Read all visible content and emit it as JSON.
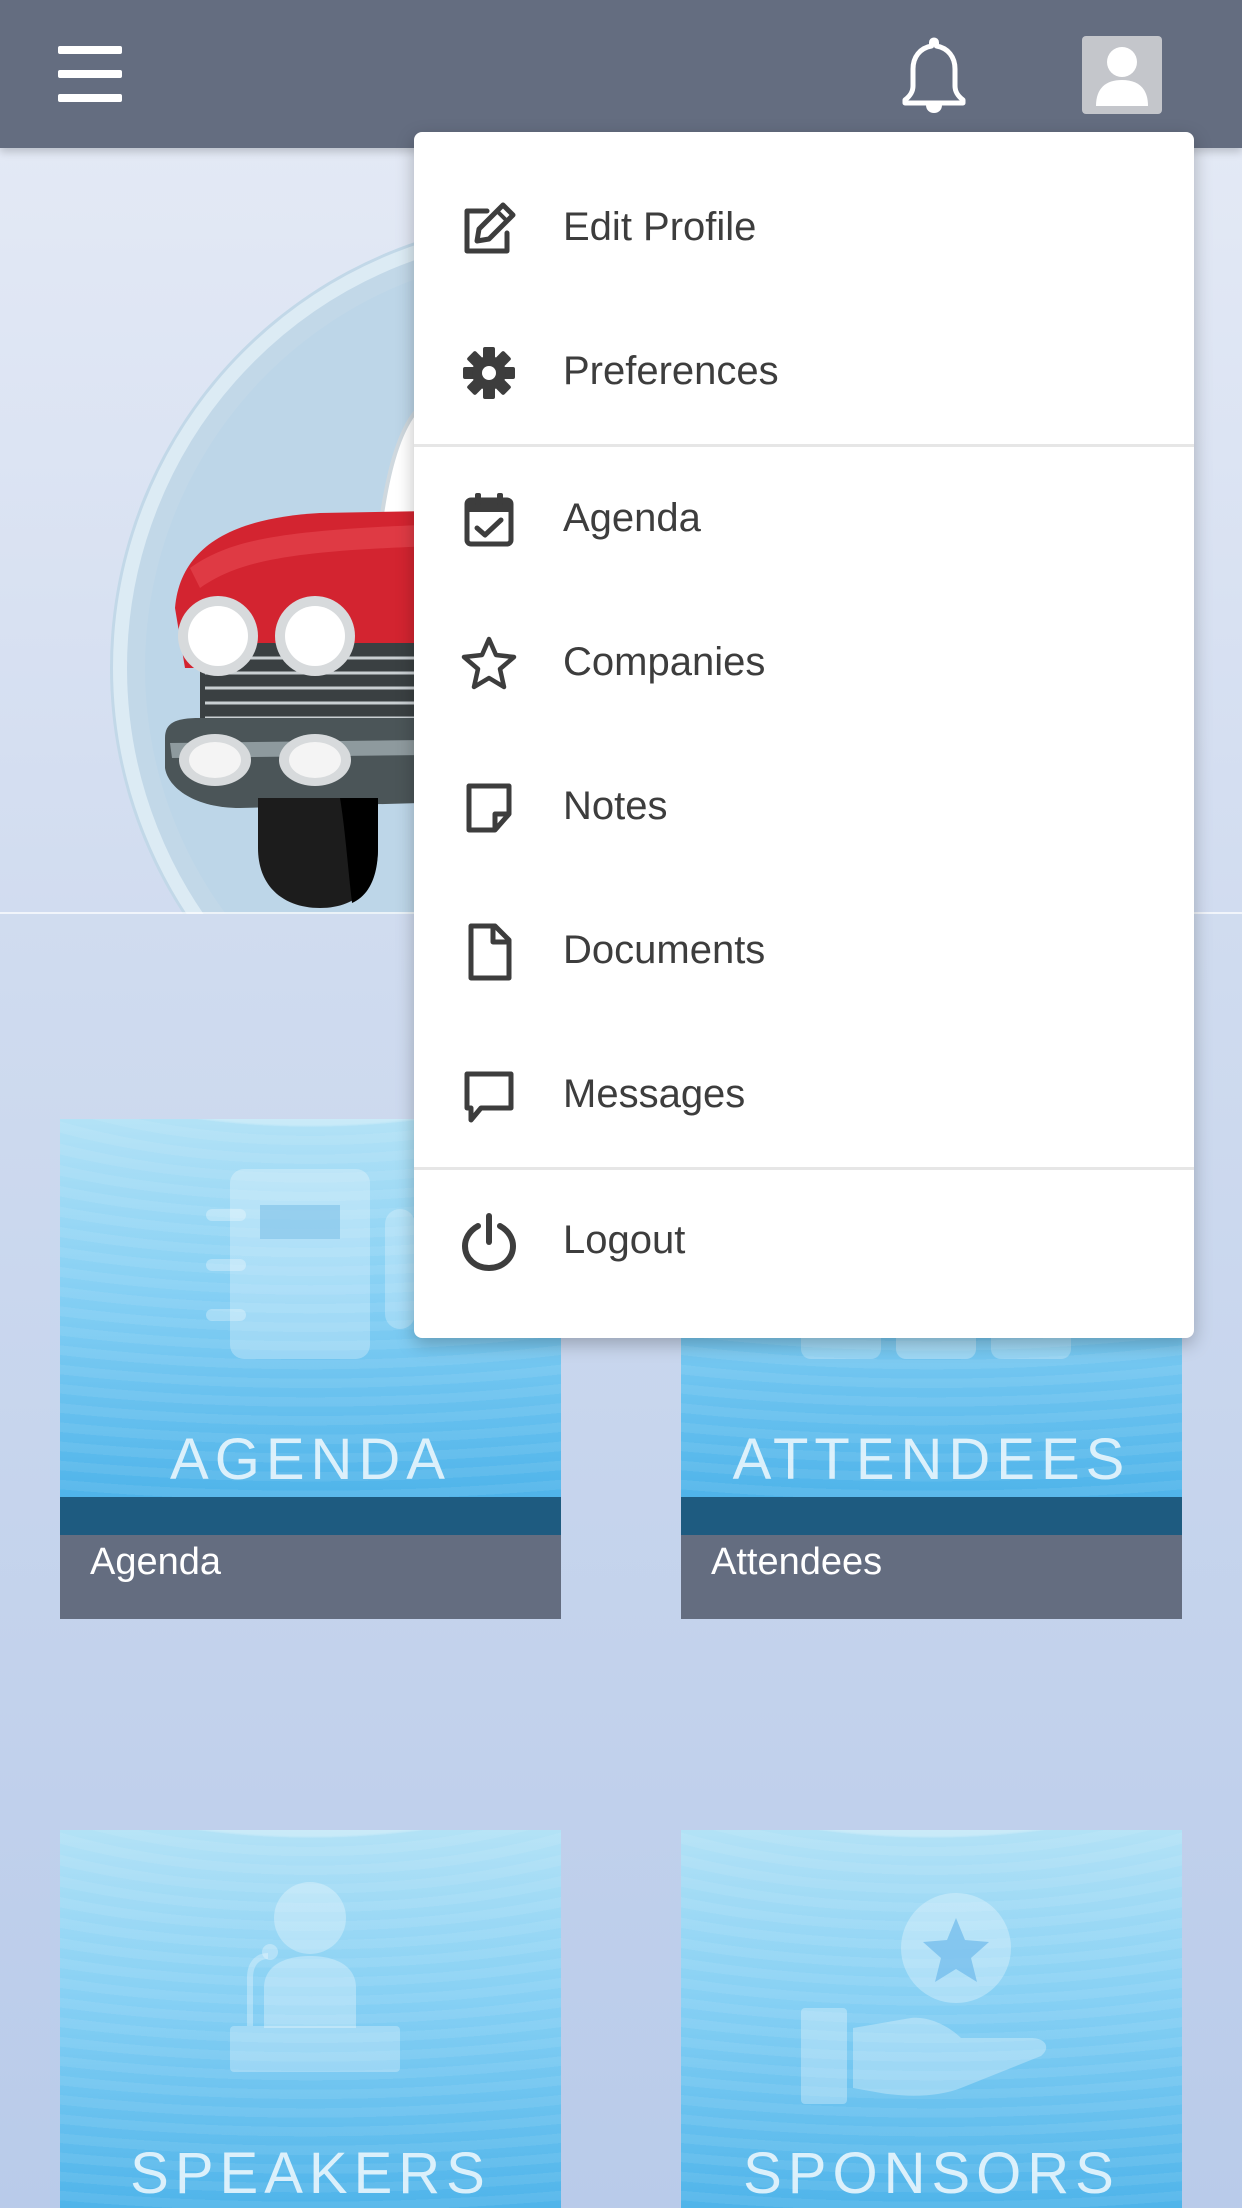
{
  "topbar": {
    "menu_icon": "hamburger-icon",
    "notification_icon": "bell-icon",
    "profile_icon": "user-avatar-icon",
    "background_color": "#646d80"
  },
  "user_menu": {
    "items": [
      {
        "label": "Edit Profile",
        "icon": "edit-icon"
      },
      {
        "label": "Preferences",
        "icon": "gear-icon"
      },
      {
        "label": "Agenda",
        "icon": "calendar-check-icon"
      },
      {
        "label": "Companies",
        "icon": "star-icon"
      },
      {
        "label": "Notes",
        "icon": "sticky-note-icon"
      },
      {
        "label": "Documents",
        "icon": "document-icon"
      },
      {
        "label": "Messages",
        "icon": "message-icon"
      },
      {
        "label": "Logout",
        "icon": "power-icon"
      }
    ]
  },
  "tiles": [
    {
      "word": "AGENDA",
      "caption": "Agenda",
      "icon": "notebook-icon"
    },
    {
      "word": "ATTENDEES",
      "caption": "Attendees",
      "icon": "people-icon"
    },
    {
      "word": "SPEAKERS",
      "caption": "",
      "icon": "speaker-podium-icon"
    },
    {
      "word": "SPONSORS",
      "caption": "",
      "icon": "hand-star-icon"
    }
  ],
  "colors": {
    "tile_top": "#b3e2f6",
    "tile_bottom": "#4fb4ea",
    "tile_strip": "#1e5b80",
    "caption_bar": "#646d80",
    "car_body": "#d32430"
  }
}
